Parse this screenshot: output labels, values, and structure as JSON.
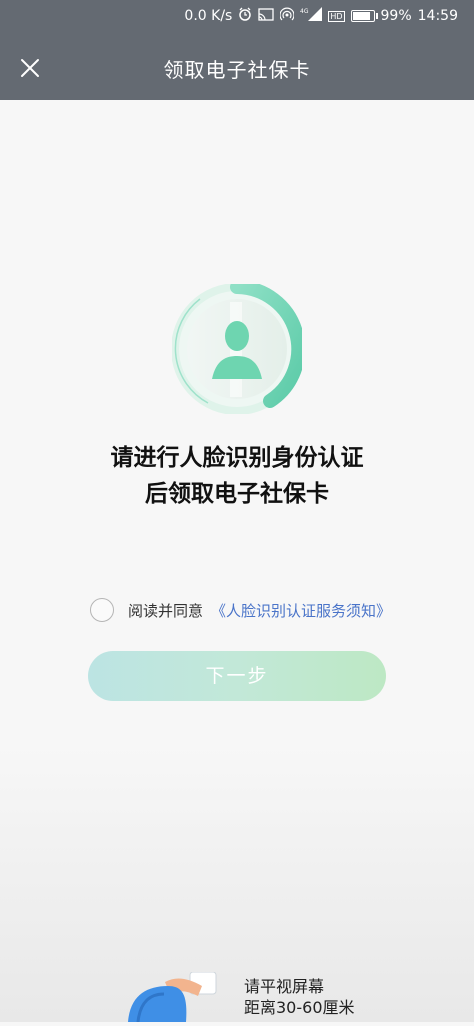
{
  "status_bar": {
    "net_speed": "0.0 K/s",
    "network": "4G",
    "hd_label": "HD",
    "battery_percent": 99,
    "battery_text": "99%",
    "time": "14:59"
  },
  "header": {
    "title": "领取电子社保卡",
    "close_icon": "close-icon"
  },
  "main": {
    "headline_line1": "请进行人脸识别身份认证",
    "headline_line2": "后领取电子社保卡",
    "agree_text": "阅读并同意",
    "agree_link": "《人脸识别认证服务须知》",
    "agree_checked": false,
    "next_button": "下一步"
  },
  "tip": {
    "line1": "请平视屏幕",
    "line2": "距离30-60厘米"
  },
  "colors": {
    "header_bg": "#646a72",
    "accent_green": "#6fd5b3",
    "link": "#4a74c9"
  }
}
